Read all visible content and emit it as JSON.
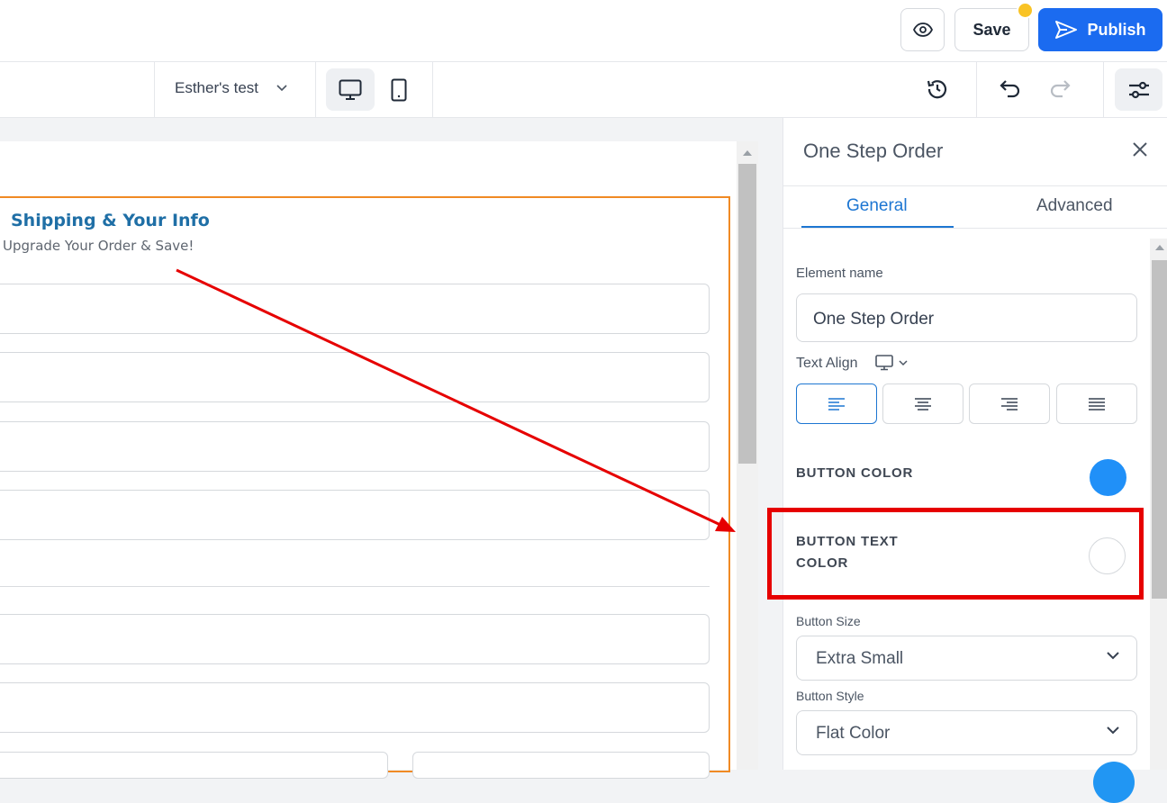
{
  "header": {
    "save_label": "Save",
    "publish_label": "Publish"
  },
  "toolbar": {
    "page_name": "Esther's test"
  },
  "canvas": {
    "form_title": "Shipping & Your Info",
    "form_subtitle": "Upgrade Your Order & Save!"
  },
  "panel": {
    "title": "One Step Order",
    "tabs": [
      {
        "label": "General"
      },
      {
        "label": "Advanced"
      }
    ],
    "element_name_label": "Element name",
    "element_name_value": "One Step Order",
    "text_align_label": "Text Align",
    "button_color_label": "BUTTON COLOR",
    "button_color_value": "#2090f8",
    "button_text_color_line1": "BUTTON TEXT",
    "button_text_color_line2": "COLOR",
    "button_text_color_value": "#ffffff",
    "button_size_label": "Button Size",
    "button_size_value": "Extra Small",
    "button_style_label": "Button Style",
    "button_style_value": "Flat Color"
  },
  "colors": {
    "accent": "#1b6bf0",
    "tab_active": "#1d76d2",
    "selection_outline": "#f08a24",
    "annotation_red": "#e60000"
  }
}
